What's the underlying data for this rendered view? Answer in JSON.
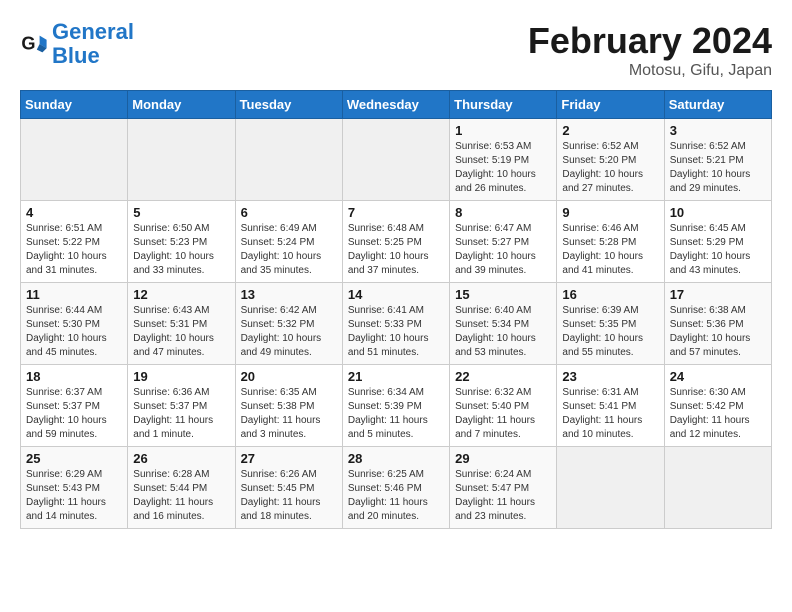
{
  "header": {
    "logo_general": "General",
    "logo_blue": "Blue",
    "title": "February 2024",
    "subtitle": "Motosu, Gifu, Japan"
  },
  "days_of_week": [
    "Sunday",
    "Monday",
    "Tuesday",
    "Wednesday",
    "Thursday",
    "Friday",
    "Saturday"
  ],
  "weeks": [
    [
      {
        "num": "",
        "detail": ""
      },
      {
        "num": "",
        "detail": ""
      },
      {
        "num": "",
        "detail": ""
      },
      {
        "num": "",
        "detail": ""
      },
      {
        "num": "1",
        "detail": "Sunrise: 6:53 AM\nSunset: 5:19 PM\nDaylight: 10 hours\nand 26 minutes."
      },
      {
        "num": "2",
        "detail": "Sunrise: 6:52 AM\nSunset: 5:20 PM\nDaylight: 10 hours\nand 27 minutes."
      },
      {
        "num": "3",
        "detail": "Sunrise: 6:52 AM\nSunset: 5:21 PM\nDaylight: 10 hours\nand 29 minutes."
      }
    ],
    [
      {
        "num": "4",
        "detail": "Sunrise: 6:51 AM\nSunset: 5:22 PM\nDaylight: 10 hours\nand 31 minutes."
      },
      {
        "num": "5",
        "detail": "Sunrise: 6:50 AM\nSunset: 5:23 PM\nDaylight: 10 hours\nand 33 minutes."
      },
      {
        "num": "6",
        "detail": "Sunrise: 6:49 AM\nSunset: 5:24 PM\nDaylight: 10 hours\nand 35 minutes."
      },
      {
        "num": "7",
        "detail": "Sunrise: 6:48 AM\nSunset: 5:25 PM\nDaylight: 10 hours\nand 37 minutes."
      },
      {
        "num": "8",
        "detail": "Sunrise: 6:47 AM\nSunset: 5:27 PM\nDaylight: 10 hours\nand 39 minutes."
      },
      {
        "num": "9",
        "detail": "Sunrise: 6:46 AM\nSunset: 5:28 PM\nDaylight: 10 hours\nand 41 minutes."
      },
      {
        "num": "10",
        "detail": "Sunrise: 6:45 AM\nSunset: 5:29 PM\nDaylight: 10 hours\nand 43 minutes."
      }
    ],
    [
      {
        "num": "11",
        "detail": "Sunrise: 6:44 AM\nSunset: 5:30 PM\nDaylight: 10 hours\nand 45 minutes."
      },
      {
        "num": "12",
        "detail": "Sunrise: 6:43 AM\nSunset: 5:31 PM\nDaylight: 10 hours\nand 47 minutes."
      },
      {
        "num": "13",
        "detail": "Sunrise: 6:42 AM\nSunset: 5:32 PM\nDaylight: 10 hours\nand 49 minutes."
      },
      {
        "num": "14",
        "detail": "Sunrise: 6:41 AM\nSunset: 5:33 PM\nDaylight: 10 hours\nand 51 minutes."
      },
      {
        "num": "15",
        "detail": "Sunrise: 6:40 AM\nSunset: 5:34 PM\nDaylight: 10 hours\nand 53 minutes."
      },
      {
        "num": "16",
        "detail": "Sunrise: 6:39 AM\nSunset: 5:35 PM\nDaylight: 10 hours\nand 55 minutes."
      },
      {
        "num": "17",
        "detail": "Sunrise: 6:38 AM\nSunset: 5:36 PM\nDaylight: 10 hours\nand 57 minutes."
      }
    ],
    [
      {
        "num": "18",
        "detail": "Sunrise: 6:37 AM\nSunset: 5:37 PM\nDaylight: 10 hours\nand 59 minutes."
      },
      {
        "num": "19",
        "detail": "Sunrise: 6:36 AM\nSunset: 5:37 PM\nDaylight: 11 hours\nand 1 minute."
      },
      {
        "num": "20",
        "detail": "Sunrise: 6:35 AM\nSunset: 5:38 PM\nDaylight: 11 hours\nand 3 minutes."
      },
      {
        "num": "21",
        "detail": "Sunrise: 6:34 AM\nSunset: 5:39 PM\nDaylight: 11 hours\nand 5 minutes."
      },
      {
        "num": "22",
        "detail": "Sunrise: 6:32 AM\nSunset: 5:40 PM\nDaylight: 11 hours\nand 7 minutes."
      },
      {
        "num": "23",
        "detail": "Sunrise: 6:31 AM\nSunset: 5:41 PM\nDaylight: 11 hours\nand 10 minutes."
      },
      {
        "num": "24",
        "detail": "Sunrise: 6:30 AM\nSunset: 5:42 PM\nDaylight: 11 hours\nand 12 minutes."
      }
    ],
    [
      {
        "num": "25",
        "detail": "Sunrise: 6:29 AM\nSunset: 5:43 PM\nDaylight: 11 hours\nand 14 minutes."
      },
      {
        "num": "26",
        "detail": "Sunrise: 6:28 AM\nSunset: 5:44 PM\nDaylight: 11 hours\nand 16 minutes."
      },
      {
        "num": "27",
        "detail": "Sunrise: 6:26 AM\nSunset: 5:45 PM\nDaylight: 11 hours\nand 18 minutes."
      },
      {
        "num": "28",
        "detail": "Sunrise: 6:25 AM\nSunset: 5:46 PM\nDaylight: 11 hours\nand 20 minutes."
      },
      {
        "num": "29",
        "detail": "Sunrise: 6:24 AM\nSunset: 5:47 PM\nDaylight: 11 hours\nand 23 minutes."
      },
      {
        "num": "",
        "detail": ""
      },
      {
        "num": "",
        "detail": ""
      }
    ]
  ]
}
